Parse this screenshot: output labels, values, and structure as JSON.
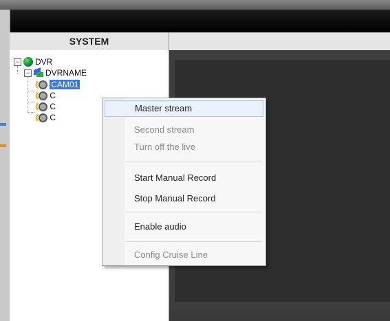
{
  "window": {
    "system_header": "SYSTEM"
  },
  "tree": {
    "root_expander": "−",
    "root_label": "DVR",
    "dvr_expander": "−",
    "dvr_label": "DVRNAME",
    "cameras": [
      {
        "label": "CAM01",
        "selected": true
      },
      {
        "label": "C",
        "selected": false
      },
      {
        "label": "C",
        "selected": false
      },
      {
        "label": "C",
        "selected": false
      }
    ]
  },
  "context_menu": {
    "items": [
      {
        "label": "Master stream",
        "state": "hover"
      },
      {
        "label": "Second stream",
        "state": "disabled"
      },
      {
        "label": "Turn off the live",
        "state": "disabled"
      },
      {
        "label": "Start Manual Record",
        "state": "normal"
      },
      {
        "label": "Stop Manual Record",
        "state": "normal"
      },
      {
        "label": "Enable audio",
        "state": "normal"
      },
      {
        "label": "Config Cruise Line",
        "state": "disabled"
      }
    ]
  },
  "colors": {
    "selection": "#3b78d8",
    "menu_hover": "#e9f1fb",
    "camera_signal": "#d99a00",
    "video_background": "#3e3e3e"
  },
  "icons": {
    "root": "globe-icon",
    "dvr": "dvr-device-icon",
    "camera": "camera-icon"
  }
}
